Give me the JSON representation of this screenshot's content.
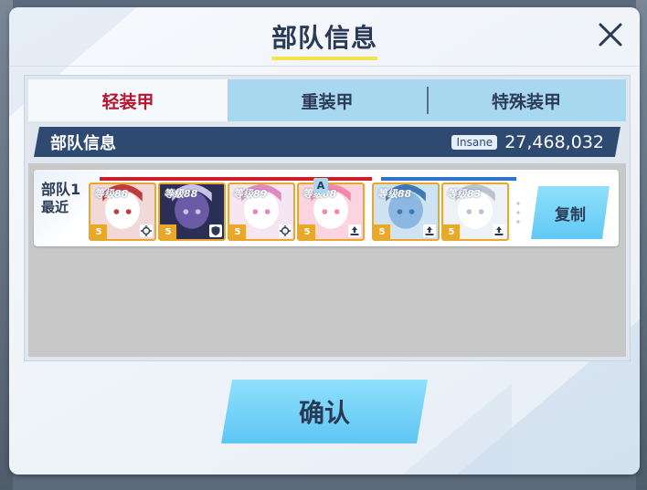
{
  "dialog": {
    "title": "部队信息",
    "close_icon": "close-icon"
  },
  "tabs": [
    {
      "label": "轻装甲",
      "active": true
    },
    {
      "label": "重装甲",
      "active": false
    },
    {
      "label": "特殊装甲",
      "active": false
    }
  ],
  "infobar": {
    "title": "部队信息",
    "difficulty": "Insane",
    "value": "27,468,032"
  },
  "team": {
    "name": "部队1",
    "subtitle": "最近",
    "striker_color": "#c8202e",
    "special_color": "#2f74c8",
    "members": [
      {
        "level": "等级88",
        "rank": "5",
        "role_icon": "crosshair-icon",
        "group": "striker",
        "palette": [
          "#f3d8d8",
          "#ffffff",
          "#c23a3a"
        ]
      },
      {
        "level": "等级88",
        "rank": "5",
        "role_icon": "shield-icon",
        "group": "striker",
        "palette": [
          "#2b2f55",
          "#6b5aa5",
          "#c9c3e8"
        ]
      },
      {
        "level": "等级89",
        "rank": "5",
        "role_icon": "crosshair-icon",
        "group": "striker",
        "palette": [
          "#f5e6f2",
          "#ffffff",
          "#e08ac0"
        ]
      },
      {
        "level": "等级88",
        "rank": "5",
        "role_icon": "support-icon",
        "group": "striker",
        "palette": [
          "#fbd4e0",
          "#ffffff",
          "#f08aa8"
        ]
      },
      {
        "level": "等级88",
        "rank": "5",
        "role_icon": "support-icon",
        "group": "special",
        "palette": [
          "#cfe3f3",
          "#8bb7e0",
          "#3e78b5"
        ]
      },
      {
        "level": "等级83",
        "rank": "5",
        "role_icon": "support-icon",
        "group": "special",
        "palette": [
          "#eef2f6",
          "#ffffff",
          "#b9c4d0"
        ]
      }
    ],
    "assist_badge": "A",
    "copy_label": "复制"
  },
  "confirm_label": "确认"
}
